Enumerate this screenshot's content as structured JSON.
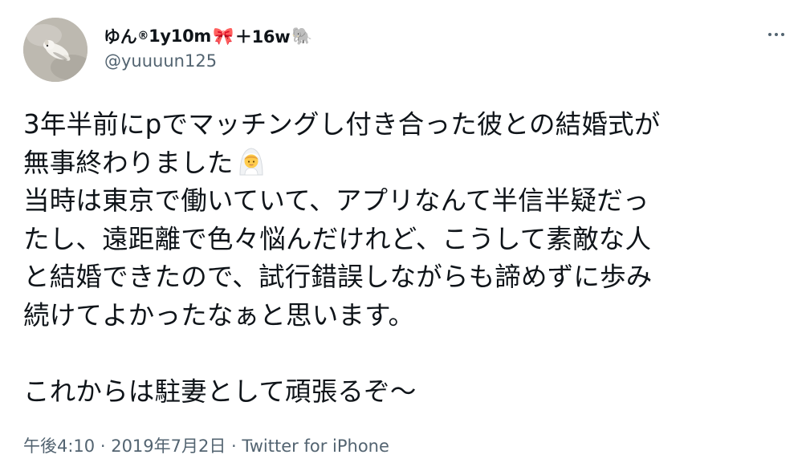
{
  "author": {
    "display_name": "ゆん",
    "registered_mark": "®",
    "display_suffix": "1y10m",
    "ribbon_emoji": "🎀",
    "display_suffix2": "＋16w",
    "elephant_emoji": "🐘",
    "handle": "@yuuuun125",
    "avatar_icon": "dog-photo-avatar"
  },
  "tweet": {
    "lines": [
      "3年半前にpでマッチングし付き合った彼との結婚式が",
      "無事終わりました",
      "当時は東京で働いていて、アプリなんて半信半疑だっ",
      "たし、遠距離で色々悩んだけれど、こうして素敵な人",
      "と結婚できたので、試行錯誤しながらも諦めずに歩み",
      "続けてよかったなぁと思います。",
      "これからは駐妻として頑張るぞ〜"
    ],
    "emoji_after_line_2": "person-with-veil-icon"
  },
  "meta": {
    "time": "午後4:10",
    "separator1": " · ",
    "date": "2019年7月2日",
    "separator2": " · ",
    "source": "Twitter for iPhone"
  },
  "icons": {
    "more": "more-options-icon"
  }
}
